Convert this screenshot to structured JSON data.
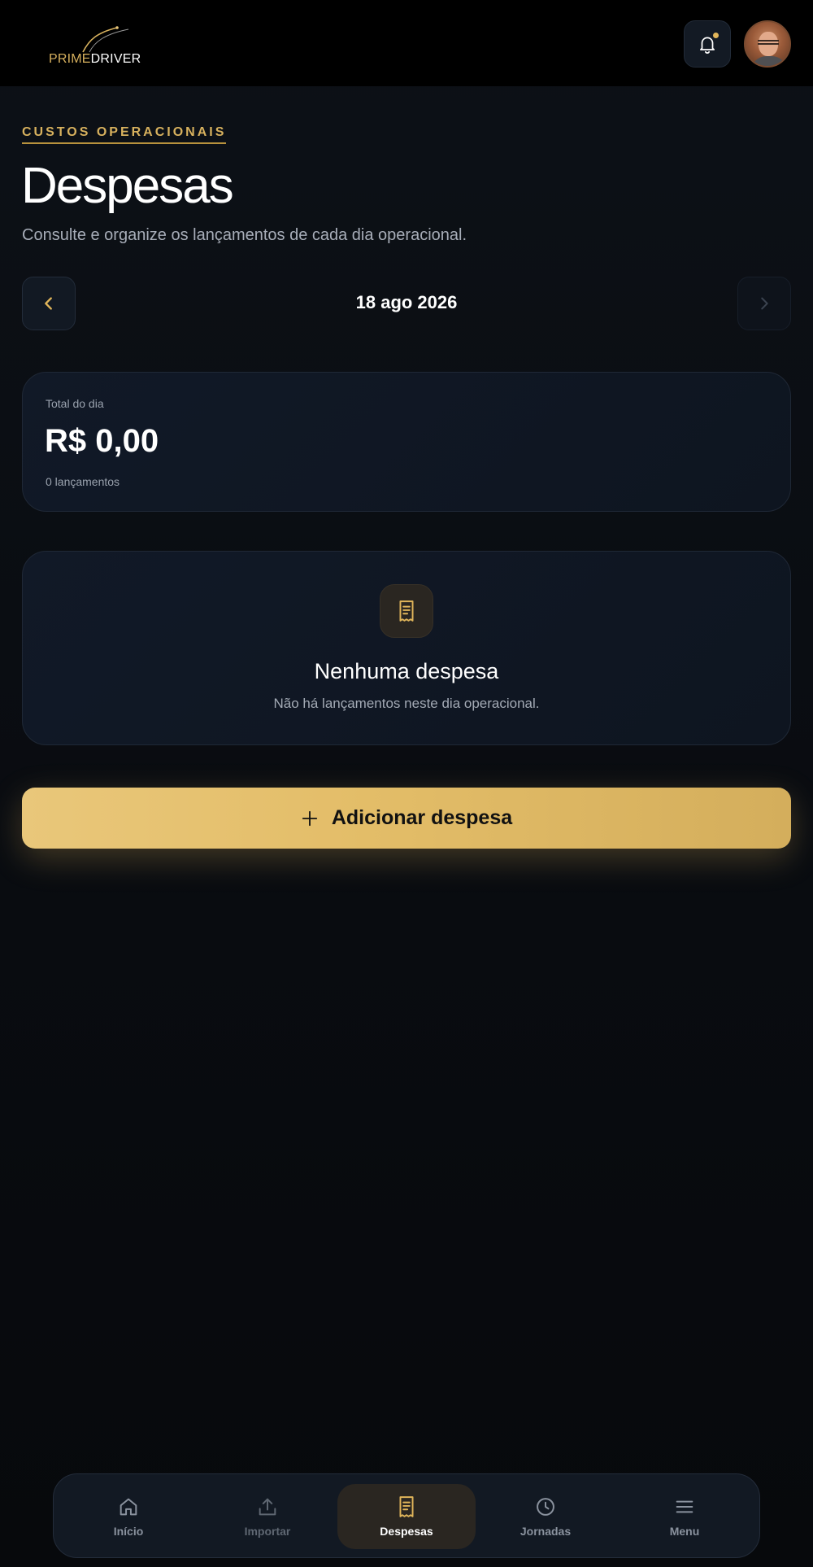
{
  "header": {
    "logo_prime": "PRIME",
    "logo_driver": "DRIVER"
  },
  "page": {
    "eyebrow": "CUSTOS OPERACIONAIS",
    "title": "Despesas",
    "subtitle": "Consulte e organize os lançamentos de cada dia operacional."
  },
  "date_nav": {
    "prev_label": "‹",
    "date": "18 ago 2026",
    "next_label": "›"
  },
  "total": {
    "label": "Total do dia",
    "value": "R$ 0,00",
    "count": "0 lançamentos"
  },
  "empty_state": {
    "title": "Nenhuma despesa",
    "subtitle": "Não há lançamentos neste dia operacional."
  },
  "add_button": {
    "label": "Adicionar despesa"
  },
  "bottom_nav": {
    "items": [
      {
        "label": "Início",
        "icon": "home-icon"
      },
      {
        "label": "Importar",
        "icon": "upload-icon"
      },
      {
        "label": "Despesas",
        "icon": "receipt-icon",
        "active": true
      },
      {
        "label": "Jornadas",
        "icon": "clock-icon"
      },
      {
        "label": "Menu",
        "icon": "menu-icon"
      }
    ]
  },
  "colors": {
    "accent": "#d7b15e",
    "background": "#07090c",
    "card": "#111927"
  }
}
